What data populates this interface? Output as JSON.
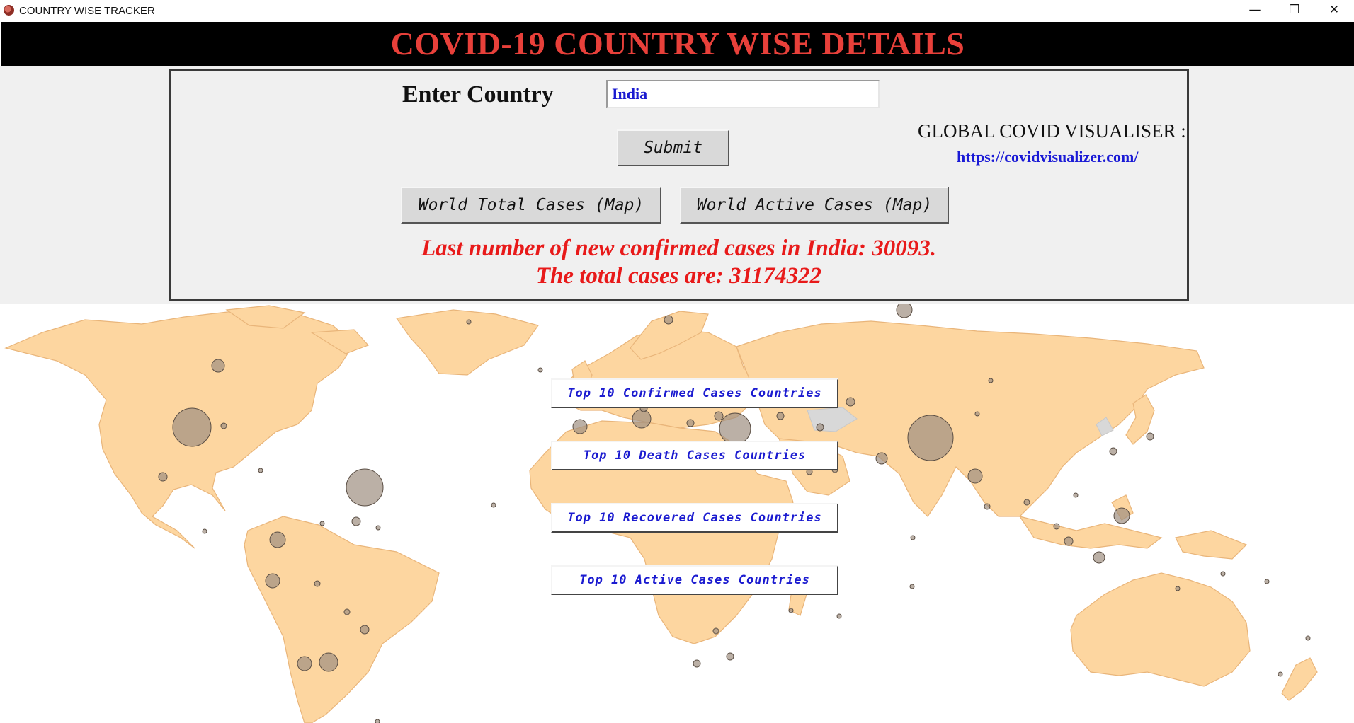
{
  "window": {
    "title": "COUNTRY WISE TRACKER",
    "controls": {
      "minimize": "—",
      "maximize": "❐",
      "close": "✕"
    }
  },
  "header": {
    "title": "COVID-19 COUNTRY WISE DETAILS"
  },
  "form": {
    "label": "Enter Country",
    "input_value": "India",
    "submit_label": "Submit"
  },
  "map_buttons": {
    "total": "World Total Cases (Map)",
    "active": "World Active Cases (Map)"
  },
  "global": {
    "label": "GLOBAL COVID VISUALISER :",
    "link": "https://covidvisualizer.com/"
  },
  "result": {
    "line1": "Last number of new confirmed cases in India: 30093.",
    "line2": "The total cases are: 31174322"
  },
  "top10_buttons": [
    "Top 10 Confirmed Cases Countries",
    "Top 10 Death Cases Countries",
    "Top 10 Recovered Cases Countries",
    "Top 10 Active Cases Countries"
  ],
  "colors": {
    "header_bg": "#000000",
    "header_text": "#e8403a",
    "result_text": "#e81a1a",
    "link": "#1a1ad6",
    "land": "#fdd6a0",
    "bubble": "#9e8f80"
  },
  "icons": {
    "app": "covid-virus-icon"
  }
}
